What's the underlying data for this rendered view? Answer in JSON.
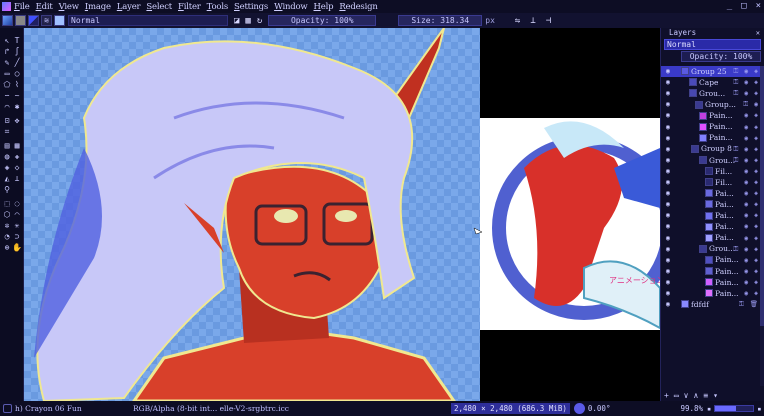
{
  "menubar": {
    "items": [
      "File",
      "Edit",
      "View",
      "Image",
      "Layer",
      "Select",
      "Filter",
      "Tools",
      "Settings",
      "Window",
      "Help",
      "Redesign"
    ],
    "window_buttons": [
      "_",
      "□",
      "×"
    ]
  },
  "tool_options": {
    "blend_mode": "Normal",
    "opacity_label": "Opacity: 100%",
    "size_label": "Size: 318.34",
    "size_unit": "px"
  },
  "layers_dock": {
    "title": "Layers",
    "blend_mode": "Normal",
    "opacity_label": "Opacity: 100%",
    "layers": [
      {
        "name": "Group 25",
        "eye": "◉",
        "thumb": "#5a5ae0",
        "flags": "⚿ ◉ ◈"
      },
      {
        "name": "Cape",
        "eye": "◉",
        "thumb": "#4a4ab8",
        "flags": "⚿ ◉ ◈"
      },
      {
        "name": "Grou...",
        "eye": "◉",
        "thumb": "#4848b0",
        "flags": "⚿ ◉ ◈"
      },
      {
        "name": "Group...",
        "eye": "◉",
        "thumb": "#3a3a90",
        "flags": "⚿ ◉"
      },
      {
        "name": "Pain...",
        "eye": "◉",
        "thumb": "#c040e0",
        "flags": "◉ ◈"
      },
      {
        "name": "Pain...",
        "eye": "◉",
        "thumb": "#e050ff",
        "flags": "◉ ◈"
      },
      {
        "name": "Pain...",
        "eye": "◉",
        "thumb": "#8080ff",
        "flags": "◉ ◈"
      },
      {
        "name": "Group 8",
        "eye": "◉",
        "thumb": "#3a3a90",
        "flags": "⚿ ◉ ◈"
      },
      {
        "name": "Grou...",
        "eye": "◉",
        "thumb": "#3a3a90",
        "flags": "⚿ ◉ ◈"
      },
      {
        "name": "Fil...",
        "eye": "◉",
        "thumb": "#2a2a70",
        "flags": "◉ ◈"
      },
      {
        "name": "Fil...",
        "eye": "◉",
        "thumb": "#2a2a70",
        "flags": "◉ ◈"
      },
      {
        "name": "Pai...",
        "eye": "◉",
        "thumb": "#6a6ae0",
        "flags": "◉ ◈"
      },
      {
        "name": "Pai...",
        "eye": "◉",
        "thumb": "#6a6ae0",
        "flags": "◉ ◈"
      },
      {
        "name": "Pai...",
        "eye": "◉",
        "thumb": "#7070f0",
        "flags": "◉ ◈"
      },
      {
        "name": "Pai...",
        "eye": "◉",
        "thumb": "#9090ff",
        "flags": "◉ ◈"
      },
      {
        "name": "Pai...",
        "eye": "◉",
        "thumb": "#a0a0ff",
        "flags": "◉ ◈"
      },
      {
        "name": "Grou...",
        "eye": "◉",
        "thumb": "#3a3a90",
        "flags": "⚿ ◉ ◈"
      },
      {
        "name": "Pain...",
        "eye": "◉",
        "thumb": "#5050c0",
        "flags": "◉ ◈"
      },
      {
        "name": "Pain...",
        "eye": "◉",
        "thumb": "#6060d0",
        "flags": "◉ ◈"
      },
      {
        "name": "Pain...",
        "eye": "◉",
        "thumb": "#d060ff",
        "flags": "◉ ◈"
      },
      {
        "name": "Pain...",
        "eye": "◉",
        "thumb": "#e070ff",
        "flags": "◉ ◈"
      },
      {
        "name": "fdfdf",
        "eye": "◉",
        "thumb": "#8a8aff",
        "flags": "⚿ 🗑"
      }
    ],
    "bottom_buttons": [
      "+",
      "▭",
      "∨",
      "∧",
      "≡",
      "▾"
    ]
  },
  "statusbar": {
    "brush_name": "h) Crayon 06 Fun",
    "color_info": "RGB/Alpha (8-bit int... elle-V2-srgbtrc.icc",
    "dimensions": "2,480 × 2,480 (686.3 MiB)",
    "rotation": "0.00°",
    "zoom": "99.8%",
    "zoom_level": 0.55
  },
  "colors": {
    "accent": "#3a3ac8",
    "canvas_bg": "#6a9ae0",
    "skin": "#d8402a",
    "hair": "#c8c8f8"
  }
}
